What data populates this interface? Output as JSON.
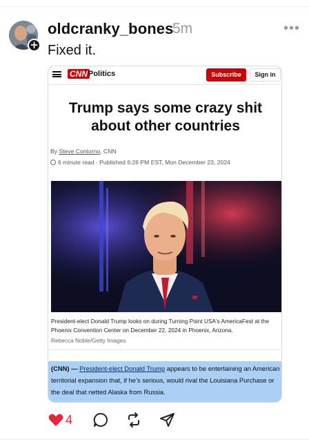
{
  "post": {
    "username": "oldcranky_bones",
    "timestamp": "5m",
    "text": "Fixed it.",
    "likes": "4"
  },
  "screenshot": {
    "site_logo": "CNN",
    "section": "Politics",
    "subscribe_label": "Subscribe",
    "signin_label": "Sign in",
    "headline": "Trump says some crazy shit about other countries",
    "byline_prefix": "By ",
    "author": "Steve Contorno",
    "byline_suffix": ", CNN",
    "meta": "6 minute read · Published 6:26 PM EST, Mon December 23, 2024",
    "caption": "President-elect Donald Trump looks on during Turning Point USA's AmericaFest at the Phoenix Convention Center on December 22, 2024 in Phoenix, Arizona.",
    "credit": "Rebecca Noble/Getty Images",
    "body_lead": "(CNN) — ",
    "body_link": "President-elect Donald Trump",
    "body_rest": " appears to be entertaining an American territorial expansion that, if he’s serious, would rival the Louisiana Purchase or the deal that netted Alaska from Russia."
  },
  "icons": {
    "more": "more-horizontal-icon",
    "like": "heart-icon",
    "reply": "comment-icon",
    "repost": "repost-icon",
    "share": "send-icon"
  },
  "colors": {
    "like": "#e8253b",
    "cnn_red": "#cc0000",
    "highlight": "#abd0f5"
  }
}
